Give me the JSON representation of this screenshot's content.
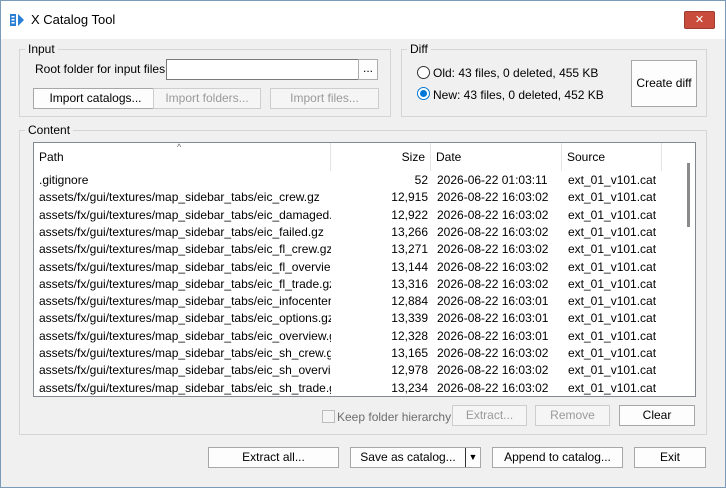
{
  "window": {
    "title": "X Catalog Tool",
    "close_label": "✕"
  },
  "input": {
    "group_label": "Input",
    "root_label": "Root folder for input files:",
    "root_value": "",
    "browse_label": "...",
    "import_catalogs": "Import catalogs...",
    "import_folders": "Import folders...",
    "import_files": "Import files..."
  },
  "diff": {
    "group_label": "Diff",
    "old_label": "Old: 43 files, 0 deleted, 455 KB",
    "new_label": "New: 43 files, 0 deleted, 452 KB",
    "create_label": "Create diff",
    "selected": "new"
  },
  "content": {
    "group_label": "Content",
    "columns": {
      "path": "Path",
      "size": "Size",
      "date": "Date",
      "source": "Source"
    },
    "sort_indicator": "^",
    "rows": [
      {
        "path": ".gitignore",
        "size": "52",
        "date": "2026-06-22 01:03:11",
        "source": "ext_01_v101.cat"
      },
      {
        "path": "assets/fx/gui/textures/map_sidebar_tabs/eic_crew.gz",
        "size": "12,915",
        "date": "2026-08-22 16:03:02",
        "source": "ext_01_v101.cat"
      },
      {
        "path": "assets/fx/gui/textures/map_sidebar_tabs/eic_damaged.gz",
        "size": "12,922",
        "date": "2026-08-22 16:03:02",
        "source": "ext_01_v101.cat"
      },
      {
        "path": "assets/fx/gui/textures/map_sidebar_tabs/eic_failed.gz",
        "size": "13,266",
        "date": "2026-08-22 16:03:02",
        "source": "ext_01_v101.cat"
      },
      {
        "path": "assets/fx/gui/textures/map_sidebar_tabs/eic_fl_crew.gz",
        "size": "13,271",
        "date": "2026-08-22 16:03:02",
        "source": "ext_01_v101.cat"
      },
      {
        "path": "assets/fx/gui/textures/map_sidebar_tabs/eic_fl_overvie...",
        "size": "13,144",
        "date": "2026-08-22 16:03:02",
        "source": "ext_01_v101.cat"
      },
      {
        "path": "assets/fx/gui/textures/map_sidebar_tabs/eic_fl_trade.gz",
        "size": "13,316",
        "date": "2026-08-22 16:03:02",
        "source": "ext_01_v101.cat"
      },
      {
        "path": "assets/fx/gui/textures/map_sidebar_tabs/eic_infocenter.gz",
        "size": "12,884",
        "date": "2026-08-22 16:03:01",
        "source": "ext_01_v101.cat"
      },
      {
        "path": "assets/fx/gui/textures/map_sidebar_tabs/eic_options.gz",
        "size": "13,339",
        "date": "2026-08-22 16:03:01",
        "source": "ext_01_v101.cat"
      },
      {
        "path": "assets/fx/gui/textures/map_sidebar_tabs/eic_overview.gz",
        "size": "12,328",
        "date": "2026-08-22 16:03:01",
        "source": "ext_01_v101.cat"
      },
      {
        "path": "assets/fx/gui/textures/map_sidebar_tabs/eic_sh_crew.gz",
        "size": "13,165",
        "date": "2026-08-22 16:03:02",
        "source": "ext_01_v101.cat"
      },
      {
        "path": "assets/fx/gui/textures/map_sidebar_tabs/eic_sh_overvie...",
        "size": "12,978",
        "date": "2026-08-22 16:03:02",
        "source": "ext_01_v101.cat"
      },
      {
        "path": "assets/fx/gui/textures/map_sidebar_tabs/eic_sh_trade.gz",
        "size": "13,234",
        "date": "2026-08-22 16:03:02",
        "source": "ext_01_v101.cat"
      }
    ],
    "keep_hierarchy": "Keep folder hierarchy",
    "extract": "Extract...",
    "remove": "Remove",
    "clear": "Clear"
  },
  "footer": {
    "extract_all": "Extract all...",
    "save_as_catalog": "Save as catalog...",
    "save_dropdown": "▼",
    "append_to_catalog": "Append to catalog...",
    "exit": "Exit"
  },
  "colors": {
    "accent": "#0078d7",
    "close": "#c94b3b",
    "icon_blue": "#2a7fd4"
  },
  "icons": {
    "app": "catalog-app-icon",
    "sort": "sort-ascending-icon"
  }
}
